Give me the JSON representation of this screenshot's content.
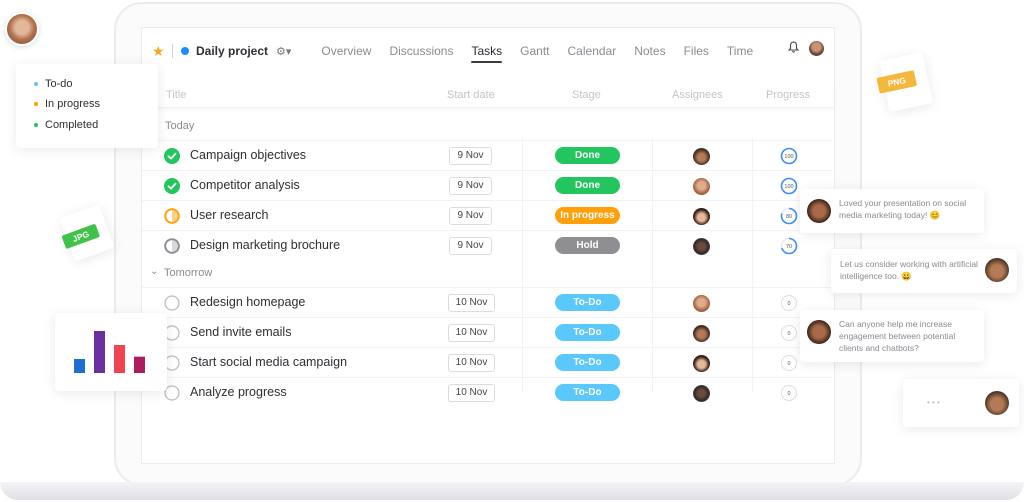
{
  "header": {
    "project_name": "Daily project",
    "project_color": "#1a8cff",
    "tabs": [
      {
        "label": "Overview",
        "active": false
      },
      {
        "label": "Discussions",
        "active": false
      },
      {
        "label": "Tasks",
        "active": true
      },
      {
        "label": "Gantt",
        "active": false
      },
      {
        "label": "Calendar",
        "active": false
      },
      {
        "label": "Notes",
        "active": false
      },
      {
        "label": "Files",
        "active": false
      },
      {
        "label": "Time",
        "active": false
      }
    ],
    "icons": {
      "favorite": "star-icon",
      "settings": "gear-icon",
      "notifications": "bell-icon"
    }
  },
  "table": {
    "columns": [
      "Title",
      "Start date",
      "Stage",
      "Assignees",
      "Progress"
    ],
    "groups": [
      {
        "label": "Today",
        "rows": [
          {
            "title": "Campaign objectives",
            "status": "completed",
            "start_date": "9 Nov",
            "stage": "Done",
            "assignee": "man-hat",
            "progress": 100
          },
          {
            "title": "Competitor analysis",
            "status": "completed",
            "start_date": "9 Nov",
            "stage": "Done",
            "assignee": "woman-glasses",
            "progress": 100
          },
          {
            "title": "User research",
            "status": "in-progress",
            "start_date": "9 Nov",
            "stage": "In progress",
            "assignee": "woman-dark-hair",
            "progress": 80
          },
          {
            "title": "Design marketing brochure",
            "status": "hold",
            "start_date": "9 Nov",
            "stage": "Hold",
            "assignee": "man-beard",
            "progress": 70
          }
        ]
      },
      {
        "label": "Tomorrow",
        "rows": [
          {
            "title": "Redesign homepage",
            "status": "todo",
            "start_date": "10 Nov",
            "stage": "To-Do",
            "assignee": "woman-glasses",
            "progress": 0
          },
          {
            "title": "Send invite emails",
            "status": "todo",
            "start_date": "10 Nov",
            "stage": "To-Do",
            "assignee": "man-hat",
            "progress": 0
          },
          {
            "title": "Start social media campaign",
            "status": "todo",
            "start_date": "10 Nov",
            "stage": "To-Do",
            "assignee": "woman-dark-hair",
            "progress": 0
          },
          {
            "title": "Analyze progress",
            "status": "todo",
            "start_date": "10 Nov",
            "stage": "To-Do",
            "assignee": "man-beard",
            "progress": 0
          }
        ]
      }
    ]
  },
  "stage_colors": {
    "Done": "#22c55e",
    "In progress": "#ff9f0a",
    "Hold": "#8e8e93",
    "To-Do": "#5ac8fa"
  },
  "legend": [
    {
      "label": "To-do",
      "color": "#5ac8fa"
    },
    {
      "label": "In progress",
      "color": "#ff9f0a"
    },
    {
      "label": "Completed",
      "color": "#22c55e"
    }
  ],
  "chat": [
    {
      "text": "Loved your presentation on social media marketing today! 😊",
      "side": "left"
    },
    {
      "text": "Let us consider working with artificial intelligence too. 😀",
      "side": "right"
    },
    {
      "text": "Can anyone help me increase engagement between potential clients and chatbots?",
      "side": "left"
    },
    {
      "text": "• • •",
      "side": "right"
    }
  ],
  "file_badges": [
    {
      "label": "PNG",
      "color": "#f3b73b"
    },
    {
      "label": "JPG",
      "color": "#3ec24a"
    }
  ],
  "mini_chart": {
    "type": "bar",
    "values": [
      3,
      9,
      6,
      3.5
    ],
    "colors": [
      "#1f6fd1",
      "#6b2fa0",
      "#f04452",
      "#b01c5b"
    ]
  }
}
